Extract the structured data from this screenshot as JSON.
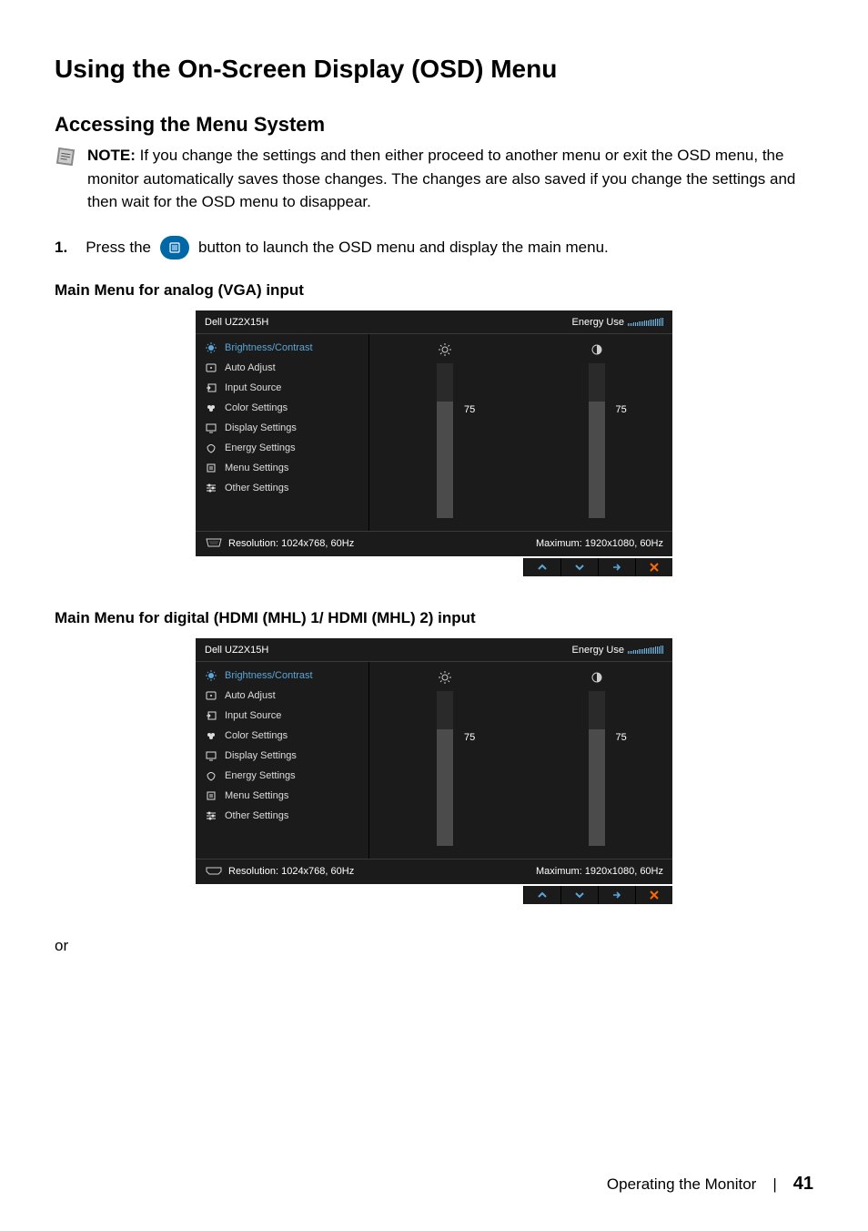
{
  "headings": {
    "h1": "Using the On-Screen Display (OSD) Menu",
    "h2": "Accessing the Menu System",
    "sub_vga": "Main Menu for analog (VGA) input",
    "sub_hdmi": "Main Menu for digital (HDMI (MHL) 1/ HDMI (MHL) 2) input"
  },
  "note": {
    "label": "NOTE:",
    "text": " If you change the settings and then either proceed to another menu or exit the OSD menu, the monitor automatically saves those changes. The changes are also saved if you change the settings and then wait for the OSD menu to disappear."
  },
  "step1": {
    "num": "1.",
    "pre": "Press the",
    "post": "button to launch the OSD menu and display the main menu."
  },
  "osd": {
    "model": "Dell UZ2X15H",
    "energy_label": "Energy Use",
    "menu": [
      "Brightness/Contrast",
      "Auto Adjust",
      "Input Source",
      "Color Settings",
      "Display Settings",
      "Energy Settings",
      "Menu Settings",
      "Other Settings"
    ],
    "brightness": 75,
    "contrast": 75,
    "resolution": "Resolution: 1024x768, 60Hz",
    "maximum": "Maximum: 1920x1080, 60Hz",
    "conn_vga": "vga",
    "conn_hdmi": "hdmi"
  },
  "or_text": "or",
  "footer": {
    "section": "Operating the Monitor",
    "page": "41"
  }
}
